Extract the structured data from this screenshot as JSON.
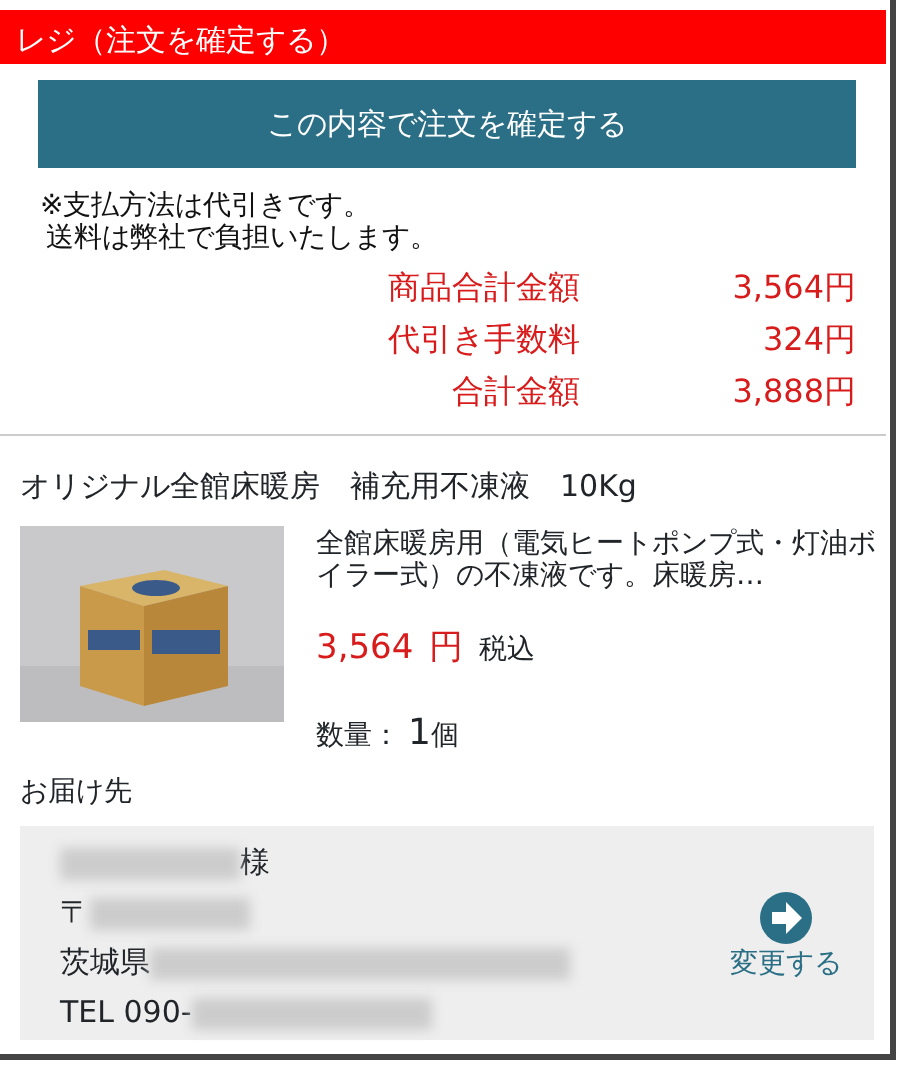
{
  "header": {
    "title": "レジ（注文を確定する）"
  },
  "confirm_button": {
    "label": "この内容で注文を確定する"
  },
  "notes": [
    "※支払方法は代引きです。",
    "送料は弊社で負担いたします。"
  ],
  "totals": [
    {
      "label": "商品合計金額",
      "value": "3,564円"
    },
    {
      "label": "代引き手数料",
      "value": "324円"
    },
    {
      "label": "合計金額",
      "value": "3,888円"
    }
  ],
  "product": {
    "title": "オリジナル全館床暖房　補充用不凍液　10Kg",
    "description": "全館床暖房用（電気ヒートポンプ式・灯油ボイラー式）の不凍液です。床暖房…",
    "price": "3,564",
    "currency": "円",
    "tax_note": "税込",
    "quantity_label": "数量：",
    "quantity": "1",
    "quantity_unit": "個"
  },
  "delivery": {
    "heading": "お届け先",
    "name_suffix": "様",
    "postal_mark": "〒",
    "prefecture": "茨城県",
    "phone_prefix": "TEL  090-",
    "change_link": "変更する"
  }
}
